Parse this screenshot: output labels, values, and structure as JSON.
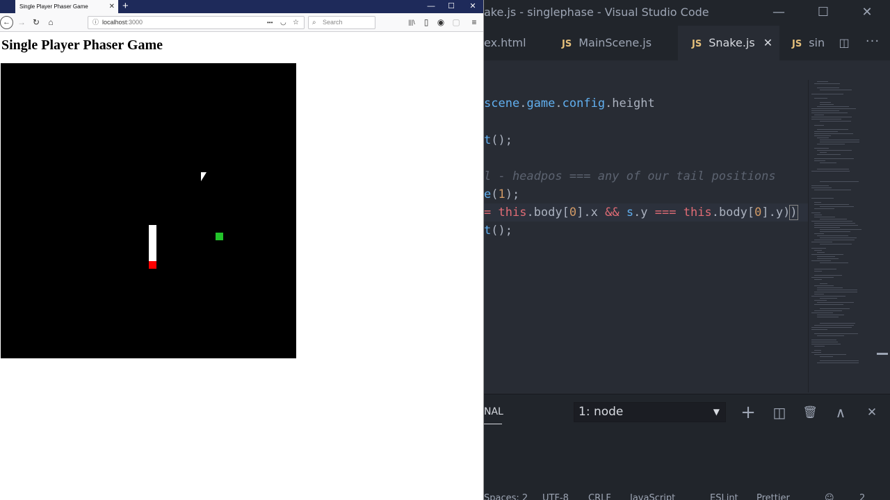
{
  "browser": {
    "tab_title": "Single Player Phaser Game",
    "tab_close": "✕",
    "new_tab": "+",
    "url_host": "localhost",
    "url_port": ":3000",
    "search_placeholder": "Search",
    "win_min": "—",
    "win_max": "☐",
    "win_close": "✕",
    "icons": {
      "back": "←",
      "forward": "→",
      "reload": "↻",
      "home": "⌂",
      "page_actions": "•••",
      "pocket": "◡",
      "bookmark": "☆",
      "library": "|||\\",
      "sidebar": "▯",
      "account": "◉",
      "extension": "▢",
      "menu": "≡"
    }
  },
  "page": {
    "heading": "Single Player Phaser Game"
  },
  "vscode": {
    "title": "ake.js - singlephase - Visual Studio Code",
    "win_min": "—",
    "win_max": "☐",
    "win_close": "✕",
    "tabs": [
      {
        "label": "ex.html",
        "js": ""
      },
      {
        "label": "MainScene.js",
        "js": "JS"
      },
      {
        "label": "Snake.js",
        "js": "JS",
        "active": true
      },
      {
        "label": "sin",
        "js": "JS"
      }
    ],
    "tab_close": "✕",
    "split_icon": "◫",
    "more_icon": "···",
    "panel": {
      "tab_label": "NAL",
      "terminal_selected": "1: node",
      "dropdown_arrow": "▼",
      "add": "+",
      "split": "◫",
      "trash": "🗑",
      "maximize": "∧",
      "close": "✕"
    },
    "status": [
      "Spaces: 2",
      "UTF-8",
      "CRLF",
      "JavaScript",
      "ESLint",
      "Prettier",
      "☺",
      "2"
    ]
  },
  "colors": {
    "firefox_tabbar": "#1e2a5a",
    "vscode_bg": "#282c34",
    "snake_body": "#ffffff",
    "snake_head": "#ff0000",
    "food": "#22c32a"
  }
}
